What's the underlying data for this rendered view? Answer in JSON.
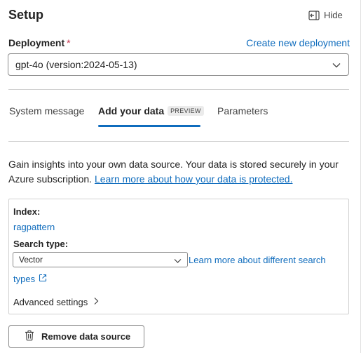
{
  "header": {
    "title": "Setup",
    "hide_label": "Hide"
  },
  "deployment": {
    "label": "Deployment",
    "required_marker": "*",
    "create_link": "Create new deployment",
    "selected_value": "gpt-4o (version:2024-05-13)"
  },
  "tabs": [
    {
      "label": "System message",
      "active": false
    },
    {
      "label": "Add your data",
      "badge": "PREVIEW",
      "active": true
    },
    {
      "label": "Parameters",
      "active": false
    }
  ],
  "add_data": {
    "description": "Gain insights into your own data source. Your data is stored securely in your Azure subscription.",
    "learn_link": "Learn more about how your data is protected.",
    "index_label": "Index:",
    "index_value": "ragpattern",
    "search_type_label": "Search type:",
    "search_type_value": "Vector",
    "search_learn_link_1": "Learn more about different search",
    "search_learn_link_2": "types",
    "advanced_label": "Advanced settings",
    "remove_button": "Remove data source"
  },
  "icons": {
    "hide": "panel-collapse-icon",
    "dropdown": "chevron-down-icon",
    "external": "open-external-icon",
    "advanced": "chevron-right-icon",
    "remove": "trash-icon"
  },
  "colors": {
    "link": "#0f6cbd",
    "required": "#c4314b",
    "tab_indicator": "#0f6cbd"
  }
}
